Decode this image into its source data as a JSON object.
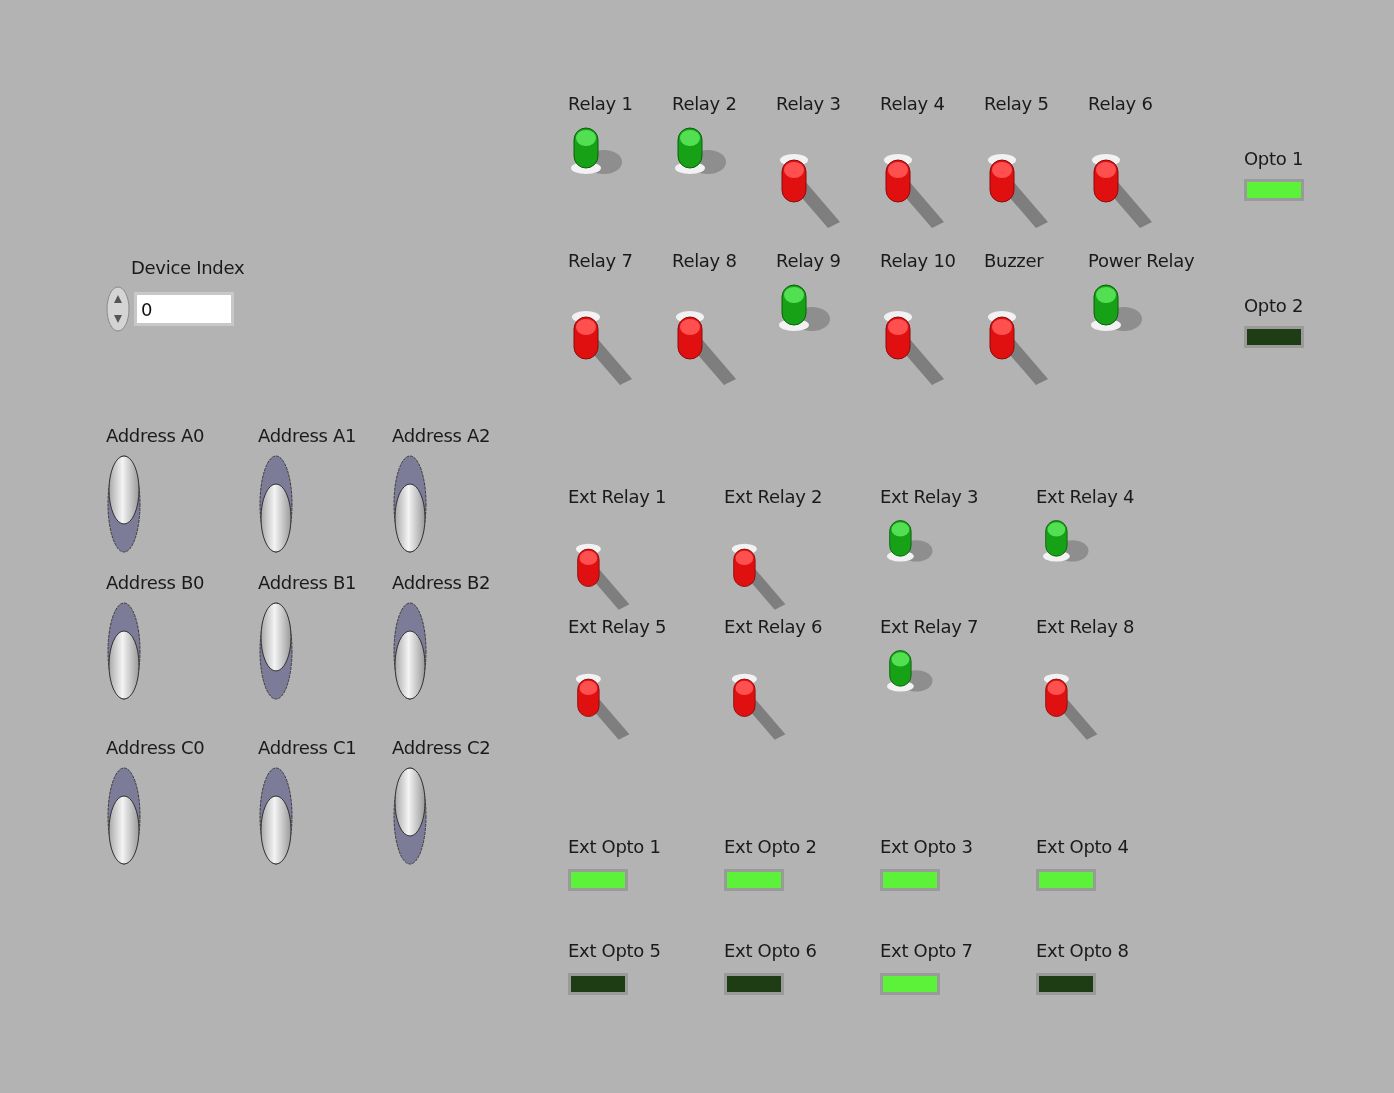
{
  "device_index": {
    "label": "Device Index",
    "value": "0"
  },
  "address_switches": [
    {
      "label": "Address A0",
      "on": true
    },
    {
      "label": "Address A1",
      "on": false
    },
    {
      "label": "Address A2",
      "on": false
    },
    {
      "label": "Address B0",
      "on": false
    },
    {
      "label": "Address B1",
      "on": true
    },
    {
      "label": "Address B2",
      "on": false
    },
    {
      "label": "Address C0",
      "on": false
    },
    {
      "label": "Address C1",
      "on": false
    },
    {
      "label": "Address C2",
      "on": true
    }
  ],
  "relays": [
    {
      "label": "Relay 1",
      "on": true
    },
    {
      "label": "Relay 2",
      "on": true
    },
    {
      "label": "Relay 3",
      "on": false
    },
    {
      "label": "Relay 4",
      "on": false
    },
    {
      "label": "Relay 5",
      "on": false
    },
    {
      "label": "Relay 6",
      "on": false
    },
    {
      "label": "Relay 7",
      "on": false
    },
    {
      "label": "Relay 8",
      "on": false
    },
    {
      "label": "Relay 9",
      "on": true
    },
    {
      "label": "Relay 10",
      "on": false
    },
    {
      "label": "Buzzer",
      "on": false
    },
    {
      "label": "Power Relay",
      "on": true
    }
  ],
  "optos": [
    {
      "label": "Opto 1",
      "on": true
    },
    {
      "label": "Opto 2",
      "on": false
    }
  ],
  "ext_relays": [
    {
      "label": "Ext Relay 1",
      "on": false
    },
    {
      "label": "Ext Relay 2",
      "on": false
    },
    {
      "label": "Ext Relay 3",
      "on": true
    },
    {
      "label": "Ext Relay 4",
      "on": true
    },
    {
      "label": "Ext Relay 5",
      "on": false
    },
    {
      "label": "Ext Relay 6",
      "on": false
    },
    {
      "label": "Ext Relay 7",
      "on": true
    },
    {
      "label": "Ext Relay 8",
      "on": false
    }
  ],
  "ext_optos": [
    {
      "label": "Ext Opto 1",
      "on": true
    },
    {
      "label": "Ext Opto 2",
      "on": true
    },
    {
      "label": "Ext Opto 3",
      "on": true
    },
    {
      "label": "Ext Opto 4",
      "on": true
    },
    {
      "label": "Ext Opto 5",
      "on": false
    },
    {
      "label": "Ext Opto 6",
      "on": false
    },
    {
      "label": "Ext Opto 7",
      "on": true
    },
    {
      "label": "Ext Opto 8",
      "on": false
    }
  ]
}
